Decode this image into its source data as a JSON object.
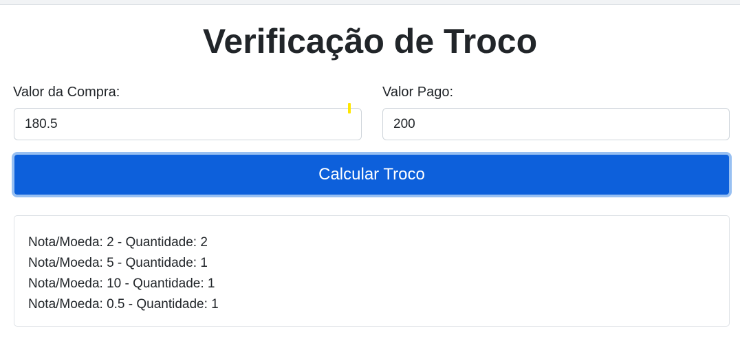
{
  "page": {
    "title": "Verificação de Troco"
  },
  "form": {
    "purchase_label": "Valor da Compra:",
    "purchase_value": "180.5",
    "paid_label": "Valor Pago:",
    "paid_value": "200",
    "calculate_label": "Calcular Troco"
  },
  "result": {
    "lines": [
      "Nota/Moeda: 2 - Quantidade: 2",
      "Nota/Moeda: 5 - Quantidade: 1",
      "Nota/Moeda: 10 - Quantidade: 1",
      "Nota/Moeda: 0.5 - Quantidade: 1"
    ]
  },
  "colors": {
    "primary_button": "#0d60db",
    "button_focus_ring": "#98c0f2",
    "text": "#212529",
    "border": "#ced4da"
  }
}
